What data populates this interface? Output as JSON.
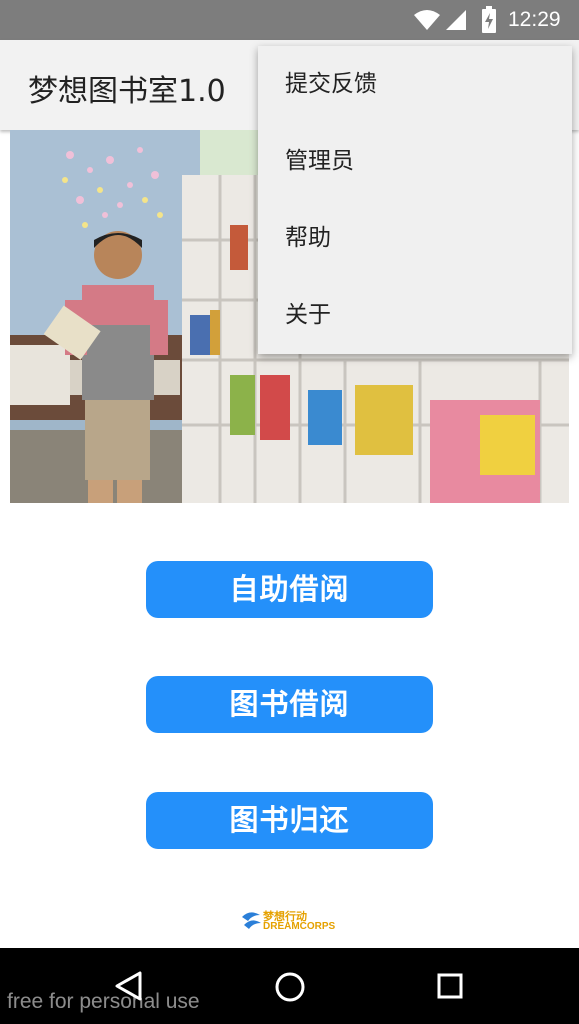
{
  "status_bar": {
    "time": "12:29"
  },
  "app_bar": {
    "title": "梦想图书室1.0"
  },
  "overflow_menu": {
    "items": [
      "提交反馈",
      "管理员",
      "帮助",
      "关于"
    ]
  },
  "buttons": {
    "self_borrow": "自助借阅",
    "book_borrow": "图书借阅",
    "book_return": "图书归还"
  },
  "logo": {
    "cn": "梦想行动",
    "en": "DREAMCORPS"
  },
  "watermark": "free for personal use",
  "colors": {
    "primary_button": "#2490fa",
    "status_bar": "#7d7d7d",
    "app_bar": "#f2f2f2",
    "logo_accent": "#e5a100"
  }
}
